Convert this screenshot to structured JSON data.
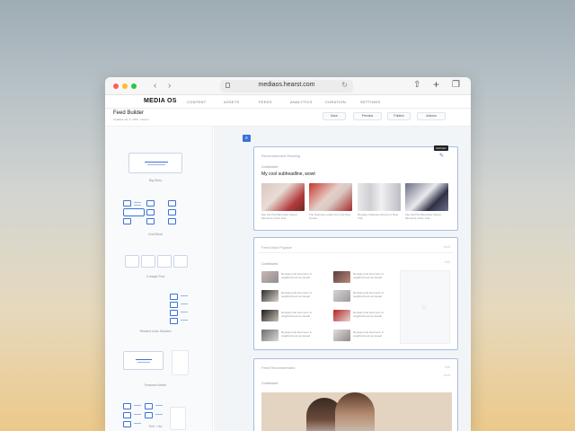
{
  "browser": {
    "url": "mediaos.hearst.com"
  },
  "app": {
    "logo": "MEDIA OS",
    "nav": [
      "CONTENT",
      "ASSETS",
      "FEEDS",
      "ANALYTICS",
      "CURATION",
      "SETTINGS"
    ]
  },
  "header": {
    "title": "Feed Builder",
    "subtitle": "Updated Jan 5, 2023 • Hearst",
    "buttons": [
      "Save",
      "Preview",
      "Publish",
      "Actions"
    ]
  },
  "sidebar": {
    "blocks": [
      {
        "label": "Big Story"
      },
      {
        "label": "Grid Block"
      },
      {
        "label": "4 Image Row"
      },
      {
        "label": "Related Links Stacked"
      },
      {
        "label": "Featured Article"
      },
      {
        "label": "Grid + Ad"
      }
    ]
  },
  "main": {
    "card1": {
      "section": "Recommended Reading",
      "label": "Contributed",
      "heading": "My cool subheadline, wowt",
      "tooltip": "Add item",
      "images": [
        {
          "caption": "See the Pics Best Red Carpet Moments of the Year"
        },
        {
          "caption": "The Stunning Looks From the Red Carpet"
        },
        {
          "caption": "Runway Collection Arrives In New York"
        },
        {
          "caption": "See the Pics Best Red Carpet Moments of the Year"
        }
      ]
    },
    "card2": {
      "title": "Feed Most Popular",
      "meta": "Limit",
      "label": "Contributed",
      "meta2": "Edit",
      "rows": [
        {
          "text": "Runway look best worn in neighborhood as casual"
        },
        {
          "text": "Runway look best worn in neighborhood as casual"
        },
        {
          "text": "Runway look best worn in neighborhood as casual"
        },
        {
          "text": "Runway look best worn in neighborhood as casual"
        },
        {
          "text": "Runway look best worn in neighborhood as casual"
        },
        {
          "text": "Runway look best worn in neighborhood as casual"
        },
        {
          "text": "Runway look best worn in neighborhood as casual"
        },
        {
          "text": "Runway look best worn in neighborhood as casual"
        }
      ]
    },
    "card3": {
      "title": "Feed Recommended",
      "meta": "Edit",
      "label": "Contributed",
      "meta2": "Limit"
    }
  },
  "colors": {
    "accent": "#3a72d6",
    "card_border": "#a9bde0"
  }
}
